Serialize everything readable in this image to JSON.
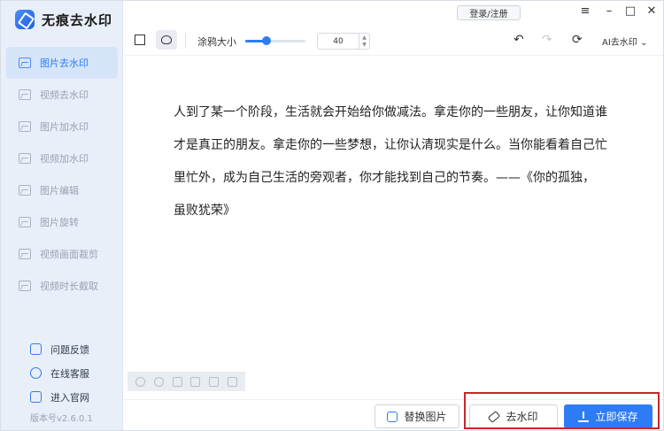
{
  "app": {
    "name": "无痕去水印",
    "version": "版本号v2.6.0.1",
    "accent": "#2d7cf6"
  },
  "sidebar": {
    "items": [
      {
        "label": "图片去水印",
        "active": true
      },
      {
        "label": "视频去水印",
        "active": false
      },
      {
        "label": "图片加水印",
        "active": false
      },
      {
        "label": "视频加水印",
        "active": false
      },
      {
        "label": "图片编辑",
        "active": false
      },
      {
        "label": "图片旋转",
        "active": false
      },
      {
        "label": "视频画面裁剪",
        "active": false
      },
      {
        "label": "视频时长截取",
        "active": false
      }
    ],
    "bottom": [
      {
        "label": "问题反馈",
        "icon": "feedback-icon"
      },
      {
        "label": "在线客服",
        "icon": "service-icon"
      },
      {
        "label": "进入官网",
        "icon": "website-icon"
      }
    ]
  },
  "topbar": {
    "login_label": "登录/注册",
    "menu_icon": "menu-icon",
    "minimize_icon": "minimize-icon",
    "maximize_icon": "maximize-icon",
    "close_icon": "close-icon"
  },
  "toolbar": {
    "brush_size_label": "涂鸦大小",
    "brush_size_value": "40",
    "slider_level": 0.35,
    "ai_label": "AI去水印",
    "undo_icon": "undo-icon",
    "redo_icon": "redo-icon",
    "ai_icon": "ai-icon"
  },
  "canvas": {
    "lines": [
      "人到了某一个阶段，生活就会开始给你做减法。拿走你的一些朋友，让你知道谁",
      "才是真正的朋友。拿走你的一些梦想，让你认清现实是什么。当你能看着自己忙",
      "里忙外，成为自己生活的旁观者，你才能找到自己的节奏。——《你的孤独，",
      "虽败犹荣》"
    ]
  },
  "bottombar": {
    "replace_label": "替换图片",
    "remove_label": "去水印",
    "save_label": "立即保存"
  }
}
